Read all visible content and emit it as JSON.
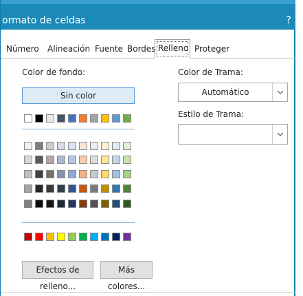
{
  "dialog": {
    "title": "ormato de celdas",
    "help": "?"
  },
  "tabs": [
    {
      "label": "Número"
    },
    {
      "label": "Alineación"
    },
    {
      "label": "Fuente"
    },
    {
      "label": "Bordes"
    },
    {
      "label": "Relleno",
      "active": true
    },
    {
      "label": "Proteger"
    }
  ],
  "background": {
    "label": "Color de fondo:",
    "no_color_button": "Sin color",
    "theme_top_row": [
      "#ffffff",
      "#000000",
      "#e7e6e6",
      "#44546a",
      "#4472c4",
      "#ed7d31",
      "#a5a5a5",
      "#ffc000",
      "#5b9bd5",
      "#70ad47"
    ],
    "theme_shade_rows": [
      [
        "#f2f2f2",
        "#7f7f7f",
        "#d0cece",
        "#d6dce4",
        "#d9e2f3",
        "#fbe5d5",
        "#ededed",
        "#fff2cc",
        "#deebf6",
        "#e2efd9"
      ],
      [
        "#d8d8d8",
        "#595959",
        "#aeaaaa",
        "#adb9ca",
        "#b4c6e7",
        "#f7cbac",
        "#dbdbdb",
        "#fee599",
        "#bdd7ee",
        "#c5e0b3"
      ],
      [
        "#bfbfbf",
        "#3f3f3f",
        "#757070",
        "#8496b0",
        "#8eaadb",
        "#f4b183",
        "#c9c9c9",
        "#ffd965",
        "#9cc3e5",
        "#a8d08d"
      ],
      [
        "#a5a5a5",
        "#262626",
        "#3a3838",
        "#323f4f",
        "#2f5496",
        "#c55a11",
        "#7b7b7b",
        "#bf9000",
        "#2e75b5",
        "#538135"
      ],
      [
        "#7f7f7f",
        "#0c0c0c",
        "#171616",
        "#222a35",
        "#1f3864",
        "#833c0b",
        "#525252",
        "#7f6000",
        "#1e4e79",
        "#375623"
      ]
    ],
    "standard_colors": [
      "#c00000",
      "#ff0000",
      "#ffc000",
      "#ffff00",
      "#92d050",
      "#00b050",
      "#00b0f0",
      "#0070c0",
      "#002060",
      "#7030a0"
    ],
    "fill_effects_button": "Efectos de relleno...",
    "more_colors_button": "Más colores..."
  },
  "pattern": {
    "color_label": "Color de Trama:",
    "color_value": "Automático",
    "style_label": "Estilo de Trama:",
    "style_value": ""
  }
}
